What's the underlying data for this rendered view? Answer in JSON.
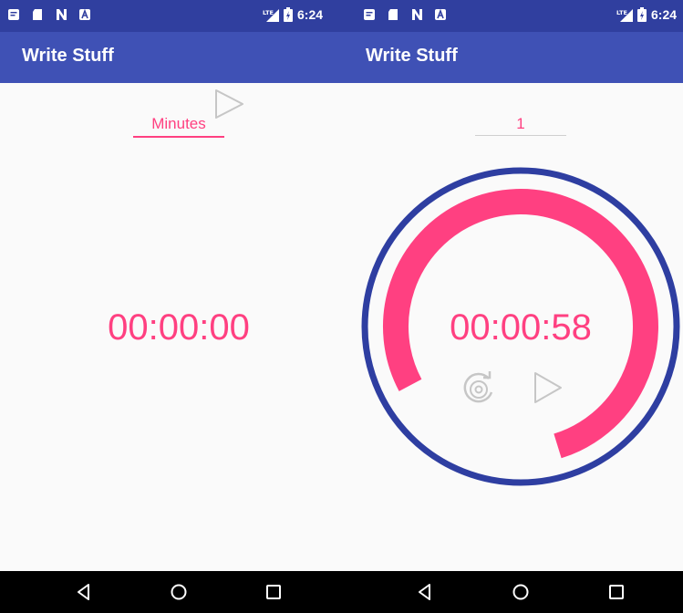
{
  "colors": {
    "status_bar": "#303f9f",
    "app_bar": "#3f51b5",
    "accent": "#ff4081",
    "ring": "#2e3ea1",
    "background": "#fafafa"
  },
  "screens": [
    {
      "status_bar": {
        "icons": [
          "notes-icon",
          "sd-card-icon",
          "n-notification-icon",
          "a-notification-icon"
        ],
        "network": "LTE",
        "time": "6:24"
      },
      "app_bar": {
        "title": "Write Stuff"
      },
      "minutes_input": {
        "placeholder": "Minutes",
        "value": ""
      },
      "timer_display": "00:00:00",
      "nav": [
        "back-icon",
        "home-icon",
        "recents-icon"
      ]
    },
    {
      "status_bar": {
        "icons": [
          "notes-icon",
          "sd-card-icon",
          "n-notification-icon",
          "a-notification-icon"
        ],
        "network": "LTE",
        "time": "6:24"
      },
      "app_bar": {
        "title": "Write Stuff"
      },
      "minutes_input": {
        "placeholder": "Minutes",
        "value": "1"
      },
      "timer_display": "00:00:58",
      "progress_fraction": 0.78,
      "nav": [
        "back-icon",
        "home-icon",
        "recents-icon"
      ]
    }
  ]
}
